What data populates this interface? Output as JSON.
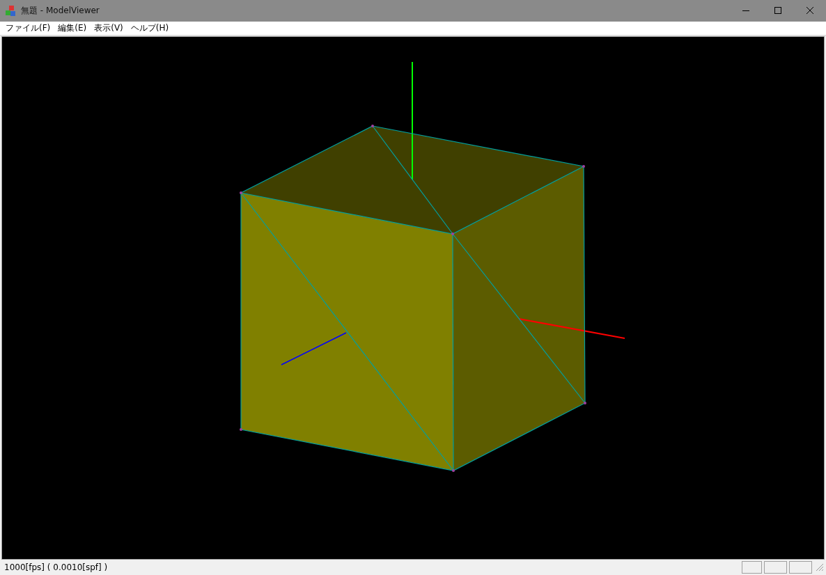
{
  "window": {
    "title": "無題 - ModelViewer"
  },
  "menu": [
    {
      "label": "ファイル(F)"
    },
    {
      "label": "編集(E)"
    },
    {
      "label": "表示(V)"
    },
    {
      "label": "ヘルプ(H)"
    }
  ],
  "status_bar": {
    "text": "1000[fps] ( 0.0010[spf] )"
  }
}
